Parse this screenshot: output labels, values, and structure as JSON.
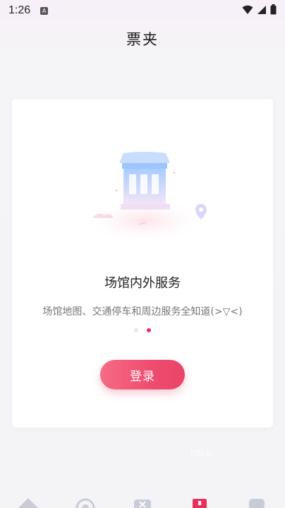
{
  "status_bar": {
    "time": "1:26",
    "notification_badge": "A",
    "icons": [
      "wifi-icon",
      "signal-icon",
      "battery-icon"
    ]
  },
  "header": {
    "title": "票夹"
  },
  "card": {
    "illustration": "venue-building-illustration",
    "feature_title": "场馆内外服务",
    "feature_desc": "场馆地图、交通停车和周边服务全知道(>▽<)",
    "dots": {
      "count": 2,
      "active_index": 1
    },
    "login_label": "登录"
  },
  "watermark": "i99 k",
  "bottom_tabs": [
    {
      "icon": "home-icon"
    },
    {
      "icon": "discover-icon"
    },
    {
      "icon": "ticket-x-icon"
    },
    {
      "icon": "ticket-wallet-icon"
    },
    {
      "icon": "profile-icon"
    }
  ],
  "colors": {
    "accent": "#e8305e",
    "button_start": "#f66b84",
    "button_end": "#e84466",
    "background": "#f4f4f6"
  }
}
